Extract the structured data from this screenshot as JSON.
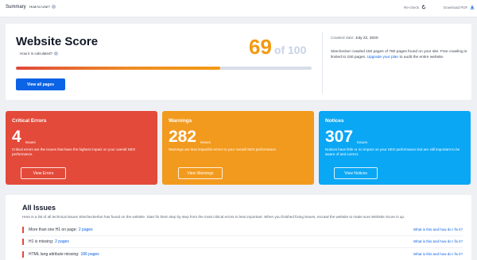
{
  "topbar": {
    "summary": "Summary",
    "how_to_use": "How to Use?",
    "recheck": "Re-check",
    "download_pdf": "Download PDF"
  },
  "score": {
    "title": "Website Score",
    "how_calculated": "How it is calculated?",
    "value": "69",
    "of_label": "of 100",
    "progress_fraction": 0.69,
    "button_label": "View all pages",
    "crawled_label": "Crawled date:",
    "crawled_date": "July 22, 2020",
    "crawl_text_before": "Sitechecker crawled 150 pages of 780 pages found on your site. Free crawling is limited to 150 pages.",
    "upgrade_link": "Upgrade your plan",
    "crawl_text_after": "to audit the entire website."
  },
  "cards": {
    "critical": {
      "title": "Critical Errors",
      "count": "4",
      "unit": "Issues",
      "description": "Critical errors are the issues that have the highest impact on your overall SEO performance.",
      "button": "View Errors"
    },
    "warnings": {
      "title": "Warnings",
      "count": "282",
      "unit": "Issues",
      "description": "Warnings are less impactful errors to your overall SEO performance.",
      "button": "View Warnings"
    },
    "notices": {
      "title": "Notices",
      "count": "307",
      "unit": "Issues",
      "description": "Notices have little or no impact on your SEO performance but are still important to be aware of and correct.",
      "button": "View Notices"
    }
  },
  "issues": {
    "title": "All Issues",
    "description": "Here is a list of all technical issues Sitecheckerbot has found on the website. Start fix them step by step from the most critical errors to less important. When you finished fixing issues, recrawl the website to make sure Website Score is up.",
    "rows": [
      {
        "label": "More than one H1 on page:",
        "link": "2 pages",
        "howfix": "What is this and how do I fix it?"
      },
      {
        "label": "H1 is missing:",
        "link": "2 pages",
        "howfix": "What is this and how do I fix it?"
      },
      {
        "label": "HTML lang attribute missing:",
        "link": "186 pages",
        "howfix": "What is this and how do I fix it?"
      }
    ]
  },
  "colors": {
    "accent": "#0b63e6",
    "score": "#f29a12",
    "critical": "#e34a3a",
    "warnings": "#f29a1e",
    "notices": "#0aa7f5"
  },
  "icons": {
    "help": "question-circle-icon",
    "recheck": "refresh-icon",
    "download": "download-icon"
  }
}
